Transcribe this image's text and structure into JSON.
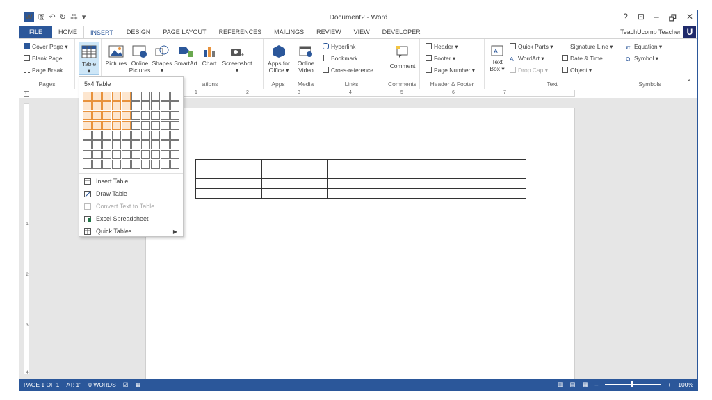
{
  "window": {
    "title": "Document2 - Word",
    "user": "TeachUcomp Teacher",
    "user_logo": "U",
    "controls": [
      "?",
      "⊡",
      "–",
      "🗗",
      "✕"
    ]
  },
  "tabs": [
    "FILE",
    "HOME",
    "INSERT",
    "DESIGN",
    "PAGE LAYOUT",
    "REFERENCES",
    "MAILINGS",
    "REVIEW",
    "VIEW",
    "DEVELOPER"
  ],
  "active_tab": "INSERT",
  "ribbon": {
    "pages": {
      "label": "Pages",
      "items": [
        "Cover Page ▾",
        "Blank Page",
        "Page Break"
      ]
    },
    "tables": {
      "table_label": "Table"
    },
    "illustrations": {
      "label": "ations",
      "pictures": "Pictures",
      "online_pictures_1": "Online",
      "online_pictures_2": "Pictures",
      "shapes": "Shapes",
      "smartart": "SmartArt",
      "chart": "Chart",
      "screenshot": "Screenshot"
    },
    "apps": {
      "label": "Apps",
      "line1": "Apps for",
      "line2": "Office ▾"
    },
    "media": {
      "label": "Media",
      "line1": "Online",
      "line2": "Video"
    },
    "links": {
      "label": "Links",
      "items": [
        "Hyperlink",
        "Bookmark",
        "Cross-reference"
      ]
    },
    "comments": {
      "label": "Comments",
      "comment": "Comment"
    },
    "header_footer": {
      "label": "Header & Footer",
      "items": [
        "Header ▾",
        "Footer ▾",
        "Page Number ▾"
      ]
    },
    "text": {
      "label": "Text",
      "textbox_1": "Text",
      "textbox_2": "Box ▾",
      "items": [
        "Quick Parts ▾",
        "WordArt ▾",
        "Drop Cap ▾"
      ],
      "items2": [
        "Signature Line ▾",
        "Date & Time",
        "Object ▾"
      ]
    },
    "symbols": {
      "label": "Symbols",
      "items": [
        "Equation ▾",
        "Symbol ▾"
      ]
    }
  },
  "ruler": {
    "numbers": [
      "1",
      "2",
      "3",
      "4",
      "5",
      "6",
      "7"
    ],
    "vnumbers": [
      "1",
      "2",
      "3",
      "4"
    ]
  },
  "dropdown": {
    "title": "5x4 Table",
    "grid_cols": 10,
    "grid_rows": 8,
    "selected_cols": 5,
    "selected_rows": 4,
    "items": [
      {
        "label": "Insert Table...",
        "disabled": false
      },
      {
        "label": "Draw Table",
        "disabled": false
      },
      {
        "label": "Convert Text to Table...",
        "disabled": true
      },
      {
        "label": "Excel Spreadsheet",
        "disabled": false
      },
      {
        "label": "Quick Tables",
        "disabled": false,
        "submenu": true
      }
    ]
  },
  "document": {
    "table_rows": 4,
    "table_cols": 5
  },
  "status": {
    "page": "PAGE 1 OF 1",
    "at": "AT: 1\"",
    "words": "0 WORDS",
    "zoom": "100%",
    "zoom_level": 1.0
  },
  "colors": {
    "accent": "#2b579a",
    "highlight": "#e8923c"
  }
}
